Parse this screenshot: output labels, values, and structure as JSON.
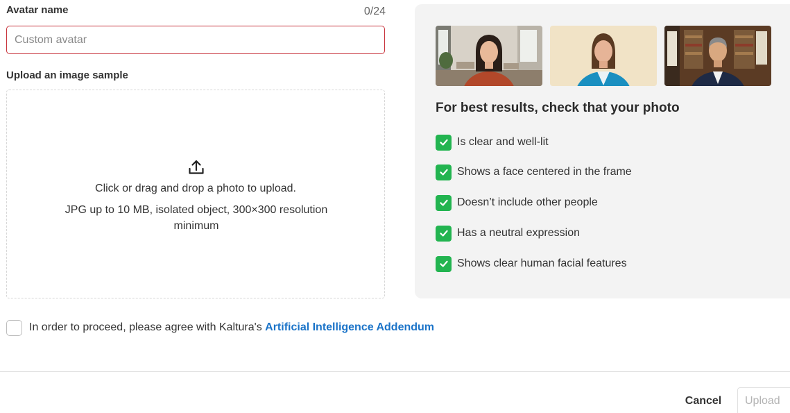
{
  "form": {
    "name_label": "Avatar name",
    "name_counter": "0/24",
    "name_value": "",
    "name_placeholder": "Custom avatar",
    "upload_label": "Upload an image sample",
    "upload_icon": "upload-icon",
    "drop_main": "Click or drag and drop a photo to upload.",
    "drop_sub": "JPG up to 10 MB, isolated object, 300×300 resolution minimum"
  },
  "tips": {
    "title": "For best results, check that your photo",
    "items": [
      "Is clear and well-lit",
      "Shows a face centered in the frame",
      "Doesn’t include other people",
      "Has a neutral expression",
      "Shows clear human facial features"
    ],
    "check_color": "#22b450"
  },
  "agreement": {
    "text": "In order to proceed, please agree with Kaltura's ",
    "link": "Artificial Intelligence Addendum",
    "checked": false,
    "link_color": "#1a73c8"
  },
  "footer": {
    "cancel": "Cancel",
    "upload": "Upload"
  },
  "colors": {
    "input_border": "#c8323b",
    "panel_bg": "#f3f3f3"
  }
}
